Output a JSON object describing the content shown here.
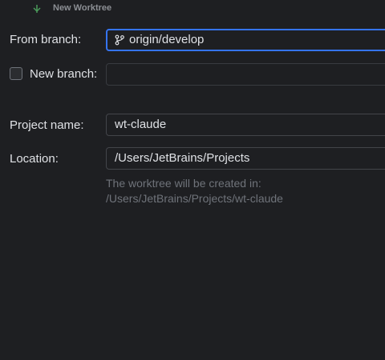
{
  "window": {
    "title": "New Worktree",
    "title_icon": "app-icon"
  },
  "form": {
    "from_branch": {
      "label": "From branch:",
      "value": "origin/develop",
      "icon": "branch-icon"
    },
    "new_branch": {
      "label": "New branch:",
      "checked": false,
      "value": ""
    },
    "project_name": {
      "label": "Project name:",
      "value": "wt-claude"
    },
    "location": {
      "label": "Location:",
      "value": "/Users/JetBrains/Projects"
    },
    "hint": {
      "line1": "The worktree will be created in:",
      "line2": "/Users/JetBrains/Projects/wt-claude"
    }
  },
  "colors": {
    "background": "#1e1f22",
    "focus_border": "#3574f0",
    "field_border": "#43454a",
    "hint_text": "#6f737a"
  }
}
